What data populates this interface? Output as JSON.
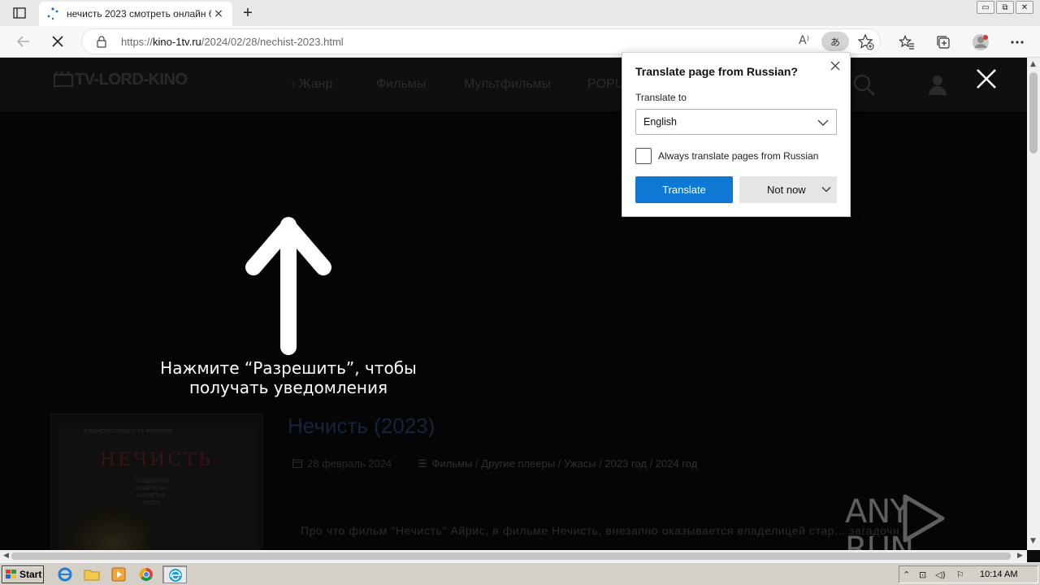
{
  "browser": {
    "tab": {
      "title": "нечисть 2023 смотреть онлайн б",
      "close": "×"
    },
    "new_tab": "+",
    "window_buttons": [
      "▭",
      "⧉",
      "✕"
    ],
    "address": {
      "prefix": "https://",
      "host": "kino-1tv.ru",
      "path": "/2024/02/28/nechist-2023.html"
    },
    "translate_badge": "あ"
  },
  "site": {
    "logo": "TV-LORD-KINO",
    "nav": [
      "Жанр",
      "Фильмы",
      "Мультфильмы",
      "POPU"
    ],
    "notify_text_line1": "Нажмите “Разрешить”, чтобы",
    "notify_text_line2": "получать уведомления",
    "movie_title": "Нечисть (2023)",
    "date": "28 февраль 2024",
    "categories": "Фильмы / Другие плееры / Ужасы / 2023 год / 2024 год",
    "description": "Про что фильм \"Нечисть\" Айрис, в фильме Нечисть, внезапно оказывается владелицей стар... загадочн",
    "poster": {
      "title": "НЕЧИСТЬ",
      "top_line": "В КИНОТЕАТРАХ С 29 ФЕВРАЛЯ",
      "sub_line1": "СОЗДАТЕЛИ",
      "sub_line2": "«ОБИТЕЛЬ»",
      "sub_line3": "ЗАКЛЯТИЕ",
      "sub_line4": "ЗЛОГО"
    }
  },
  "watermark": {
    "left": "ANY",
    "right": "RUN"
  },
  "translate_popup": {
    "title": "Translate page from Russian?",
    "translate_to_label": "Translate to",
    "language": "English",
    "always_label": "Always translate pages from Russian",
    "always_checked": false,
    "translate_button": "Translate",
    "not_now_button": "Not now",
    "accent_color": "#0f78d4"
  },
  "taskbar": {
    "start_label": "Start",
    "clock": "10:14 AM",
    "quick_launch": [
      "ie-icon",
      "folder-icon",
      "media-player-icon",
      "chrome-icon",
      "edge-icon"
    ]
  }
}
